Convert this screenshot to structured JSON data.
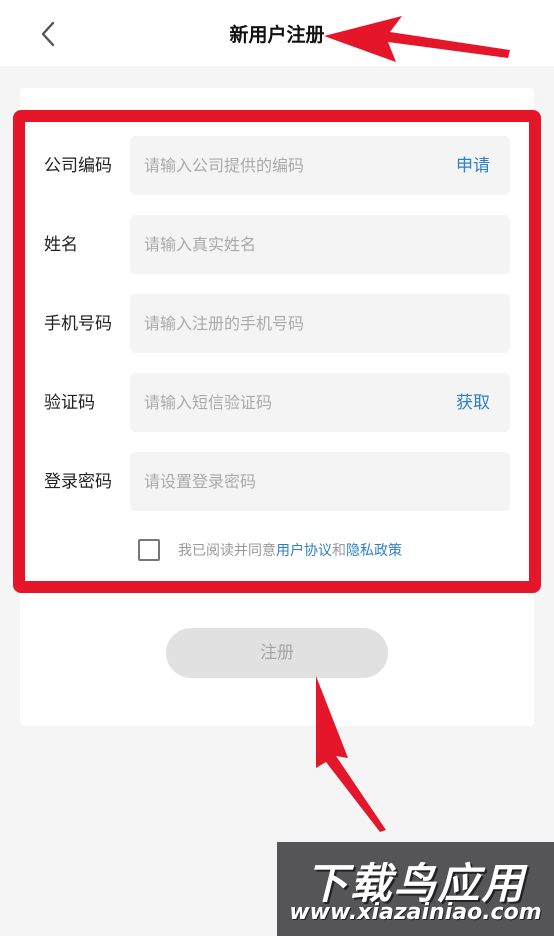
{
  "header": {
    "back_icon": "chevron-left-icon",
    "title": "新用户注册"
  },
  "form": {
    "fields": [
      {
        "label": "公司编码",
        "placeholder": "请输入公司提供的编码",
        "value": "",
        "action": "申请"
      },
      {
        "label": "姓名",
        "placeholder": "请输入真实姓名",
        "value": ""
      },
      {
        "label": "手机号码",
        "placeholder": "请输入注册的手机号码",
        "value": ""
      },
      {
        "label": "验证码",
        "placeholder": "请输入短信验证码",
        "value": "",
        "action": "获取"
      },
      {
        "label": "登录密码",
        "placeholder": "请设置登录密码",
        "value": ""
      }
    ],
    "agreement": {
      "checked": false,
      "prefix": "我已阅读并同意",
      "user_agreement": "用户协议",
      "and": "和",
      "privacy_policy": "隐私政策"
    },
    "submit_label": "注册"
  },
  "watermark": {
    "title": "下载鸟应用",
    "url": "www.xiazainiao.com"
  },
  "colors": {
    "accent": "#2e7fc5",
    "highlight": "#e5162a",
    "button_disabled": "#e1e1e1"
  }
}
